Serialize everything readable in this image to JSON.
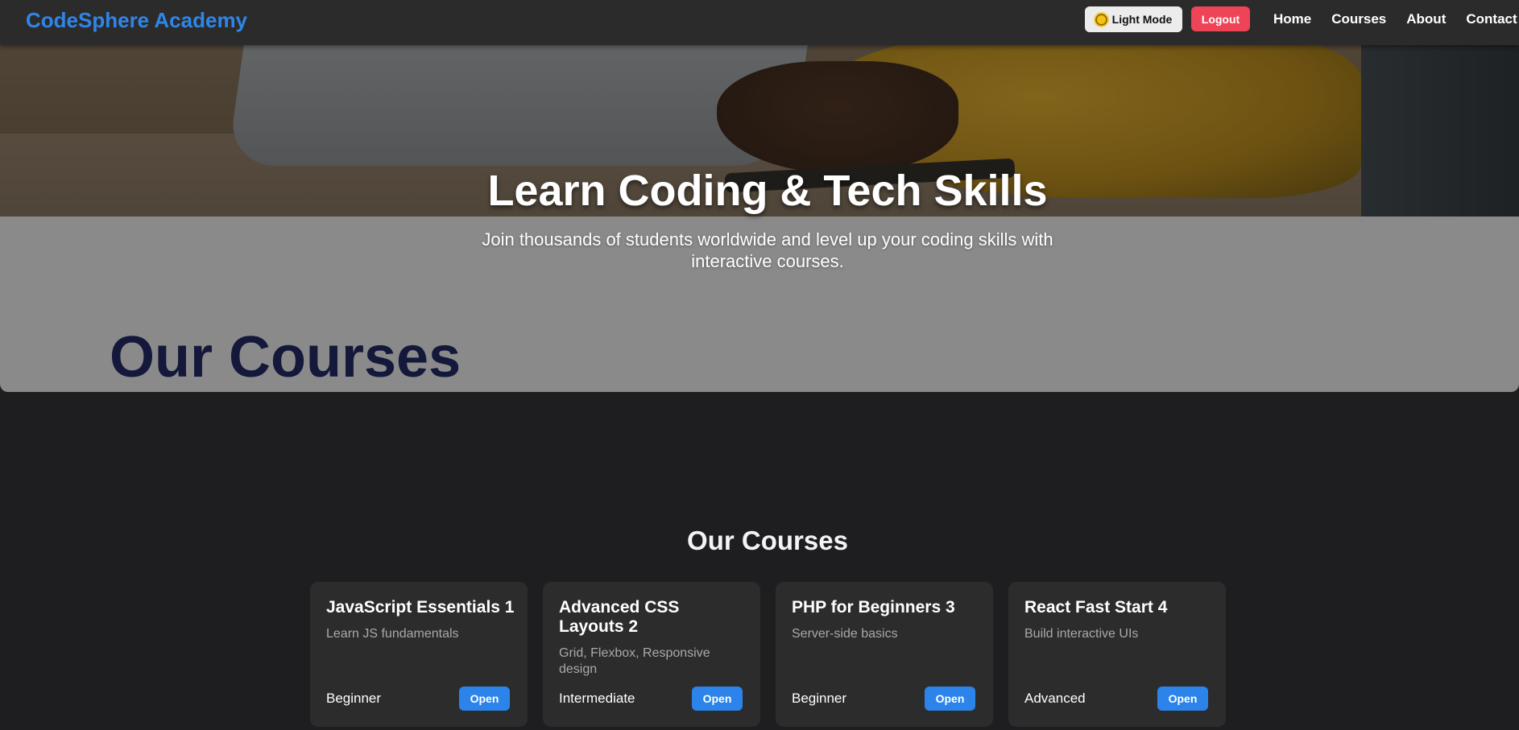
{
  "nav": {
    "brand": "CodeSphere Academy",
    "theme_toggle_label": "Light Mode",
    "theme_toggle_icon": "sun-icon",
    "logout_label": "Logout",
    "links": [
      "Home",
      "Courses",
      "About",
      "Contact"
    ]
  },
  "hero": {
    "title": "Learn Coding & Tech Skills",
    "subtitle": "Join thousands of students worldwide and level up your coding skills with interactive courses.",
    "overlay_heading": "Our Courses"
  },
  "courses_section": {
    "title": "Our Courses",
    "courses": [
      {
        "title": "JavaScript Essentials 1",
        "description": "Learn JS fundamentals",
        "level": "Beginner",
        "button": "Open"
      },
      {
        "title": "Advanced CSS Layouts 2",
        "description": "Grid, Flexbox, Responsive design",
        "level": "Intermediate",
        "button": "Open"
      },
      {
        "title": "PHP for Beginners 3",
        "description": "Server-side basics",
        "level": "Beginner",
        "button": "Open"
      },
      {
        "title": "React Fast Start 4",
        "description": "Build interactive UIs",
        "level": "Advanced",
        "button": "Open"
      }
    ]
  },
  "colors": {
    "accent": "#2f86e6",
    "logout": "#ef4457",
    "background": "#1e1e20",
    "card": "#2c2c2d"
  }
}
